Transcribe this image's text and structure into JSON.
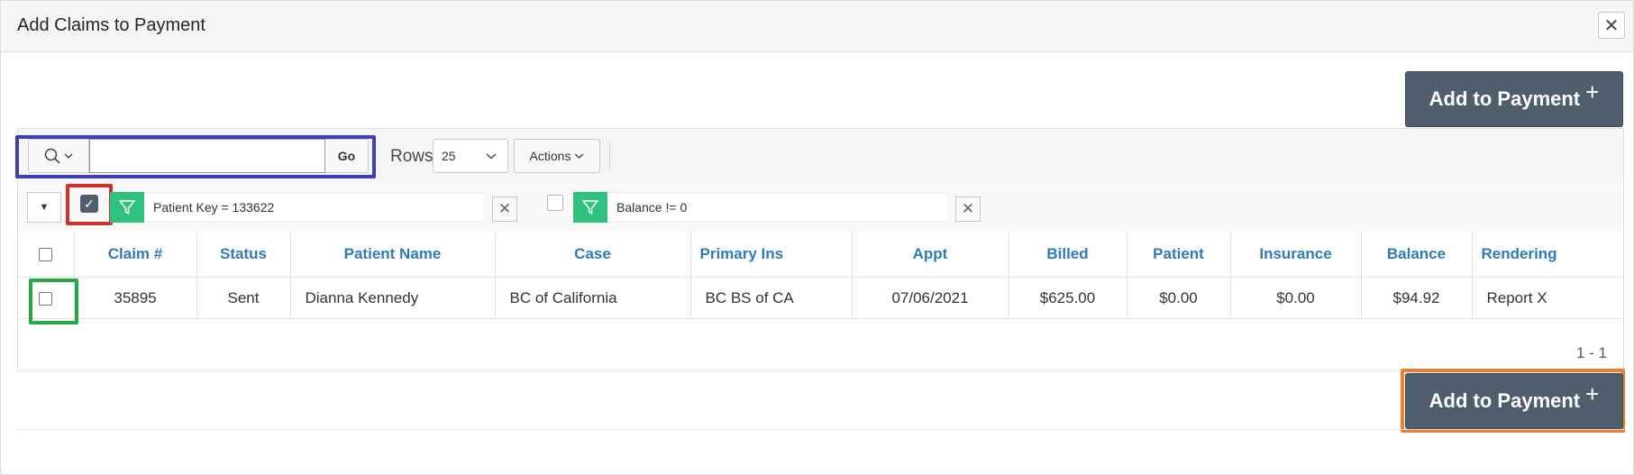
{
  "dialog": {
    "title": "Add Claims to Payment",
    "close_icon": "close-icon"
  },
  "buttons": {
    "add_to_payment_label": "Add to Payment",
    "add_icon": "plus-icon"
  },
  "toolbar": {
    "search_icon": "search-icon",
    "search_placeholder": "",
    "search_value": "",
    "go_label": "Go",
    "rows_label": "Rows",
    "rows_value": "25",
    "actions_label": "Actions"
  },
  "filters": [
    {
      "text": "Patient Key = 133622",
      "enabled": true
    },
    {
      "text": "Balance != 0",
      "enabled": false
    }
  ],
  "table": {
    "columns": [
      "Claim #",
      "Status",
      "Patient Name",
      "Case",
      "Primary Ins",
      "Appt",
      "Billed",
      "Patient",
      "Insurance",
      "Balance",
      "Rendering"
    ],
    "rows": [
      [
        "35895",
        "Sent",
        "Dianna Kennedy",
        "BC of California",
        "BC BS of CA",
        "07/06/2021",
        "$625.00",
        "$0.00",
        "$0.00",
        "$94.92",
        "Report X"
      ]
    ]
  },
  "pagination": "1 - 1",
  "colors": {
    "primary_button": "#4f5d6c",
    "header_text": "#2f7ab8",
    "filter_green": "#2ec27e",
    "highlight_blue": "#3f3fb5",
    "highlight_red": "#d32f2f",
    "highlight_green": "#27a844",
    "highlight_orange": "#f07f2d"
  }
}
